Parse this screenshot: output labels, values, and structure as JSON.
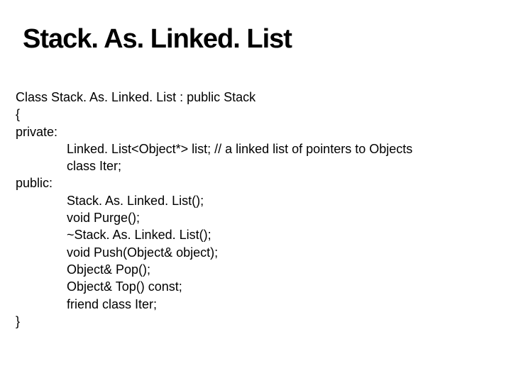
{
  "title": "Stack. As. Linked. List",
  "code": {
    "l1": "Class Stack. As. Linked. List : public Stack",
    "l2": "{",
    "l3": "private:",
    "l4": "Linked. List<Object*> list; // a linked list of pointers to Objects",
    "l5": "class Iter;",
    "l6": "public:",
    "l7": "Stack. As. Linked. List();",
    "l8": "void Purge();",
    "l9": "~Stack. As. Linked. List();",
    "l10": "void Push(Object& object);",
    "l11": "Object& Pop();",
    "l12": "Object& Top() const;",
    "l13": "friend class Iter;",
    "l14": "}"
  }
}
